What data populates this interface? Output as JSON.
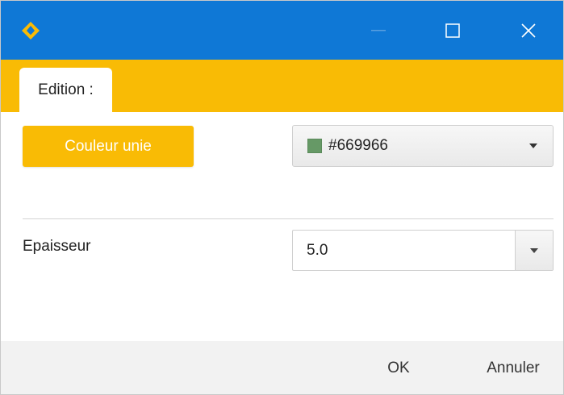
{
  "window": {
    "logo_icon": "diamond-logo-icon",
    "controls": [
      "minimize-icon",
      "maximize-icon",
      "close-icon"
    ]
  },
  "tabs": [
    {
      "label": "Edition :",
      "active": true
    }
  ],
  "fill": {
    "mode_button_label": "Couleur unie",
    "color_value": "#669966",
    "swatch_color": "#669966"
  },
  "stroke": {
    "label": "Epaisseur",
    "value": "5.0"
  },
  "footer": {
    "ok_label": "OK",
    "cancel_label": "Annuler"
  },
  "colors": {
    "titlebar": "#0f78d6",
    "accent": "#f9bb05",
    "footer": "#f2f2f2"
  }
}
